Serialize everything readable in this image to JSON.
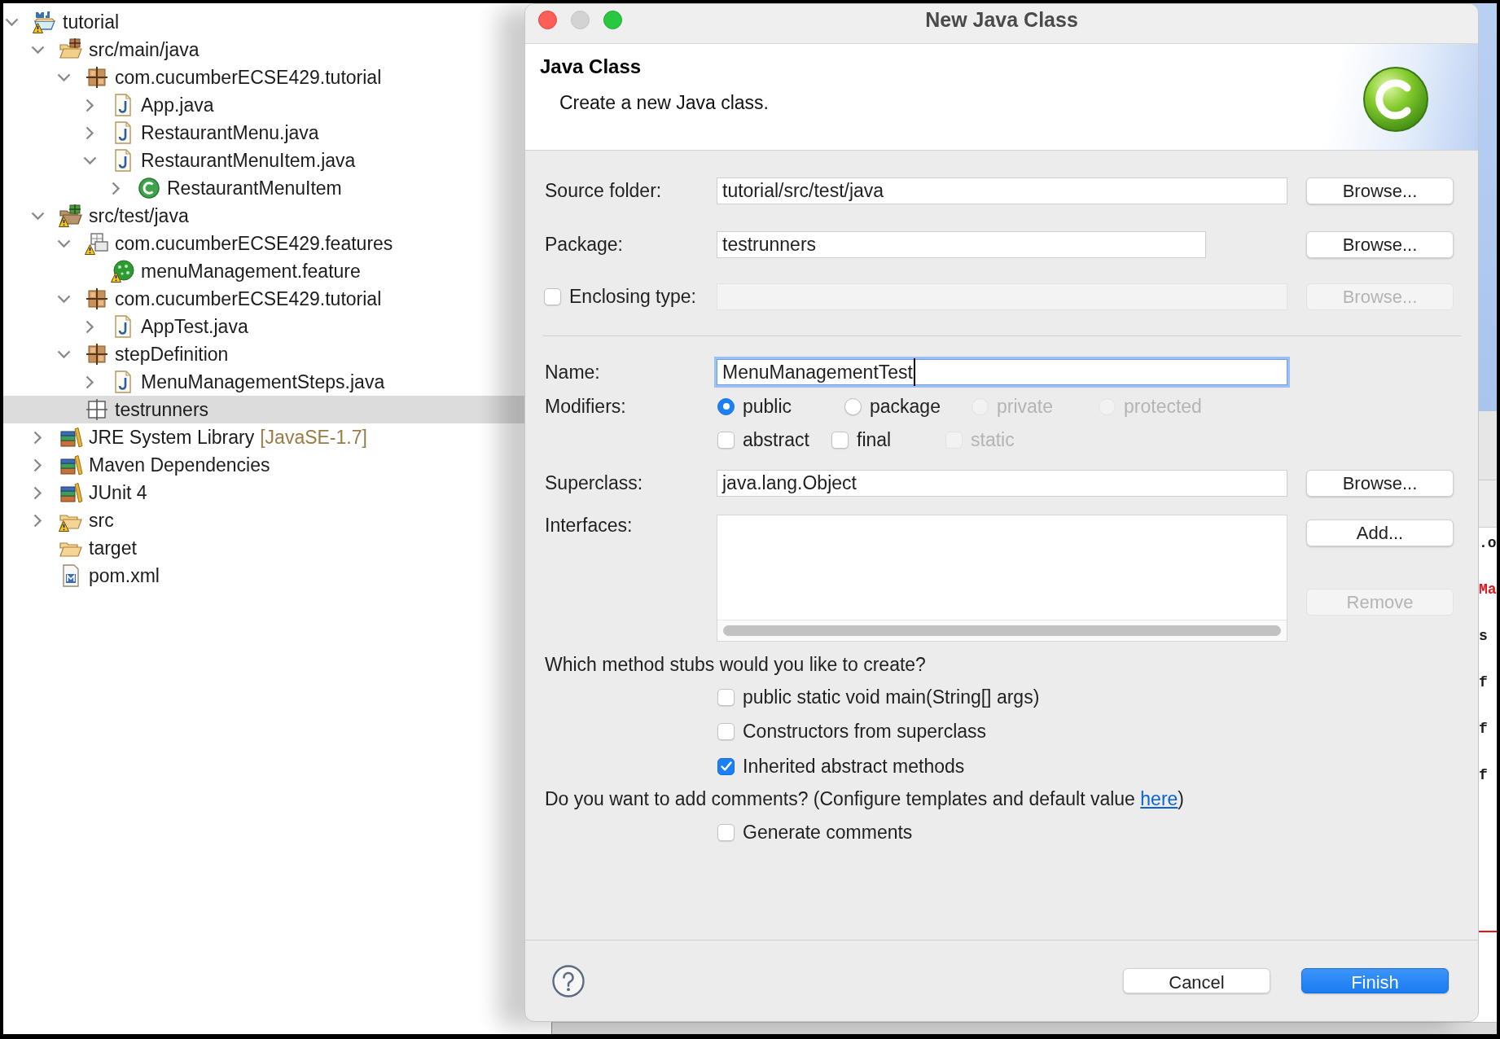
{
  "explorer": {
    "tree": [
      {
        "label": "tutorial",
        "kind": "project",
        "warning": true,
        "expanded": true,
        "selected": false,
        "children": [
          {
            "label": "src/main/java",
            "kind": "source_folder",
            "warning": false,
            "expanded": true,
            "selected": false,
            "children": [
              {
                "label": "com.cucumberECSE429.tutorial",
                "kind": "package",
                "warning": false,
                "expanded": true,
                "selected": false,
                "children": [
                  {
                    "label": "App.java",
                    "kind": "java_file",
                    "warning": false,
                    "expanded": false,
                    "selected": false
                  },
                  {
                    "label": "RestaurantMenu.java",
                    "kind": "java_file",
                    "warning": false,
                    "expanded": false,
                    "selected": false
                  },
                  {
                    "label": "RestaurantMenuItem.java",
                    "kind": "java_file",
                    "warning": false,
                    "expanded": true,
                    "selected": false,
                    "children": [
                      {
                        "label": "RestaurantMenuItem",
                        "kind": "class",
                        "warning": false,
                        "expanded": false,
                        "selected": false
                      }
                    ]
                  }
                ]
              }
            ]
          },
          {
            "label": "src/test/java",
            "kind": "test_source_folder",
            "warning": true,
            "expanded": true,
            "selected": false,
            "children": [
              {
                "label": "com.cucumberECSE429.features",
                "kind": "resource_package",
                "warning": true,
                "expanded": true,
                "selected": false,
                "children": [
                  {
                    "label": "menuManagement.feature",
                    "kind": "feature_file",
                    "warning": true,
                    "selected": false
                  }
                ]
              },
              {
                "label": "com.cucumberECSE429.tutorial",
                "kind": "package",
                "warning": false,
                "expanded": true,
                "selected": false,
                "children": [
                  {
                    "label": "AppTest.java",
                    "kind": "java_file",
                    "warning": false,
                    "expanded": false,
                    "selected": false
                  }
                ]
              },
              {
                "label": "stepDefinition",
                "kind": "package",
                "warning": false,
                "expanded": true,
                "selected": false,
                "children": [
                  {
                    "label": "MenuManagementSteps.java",
                    "kind": "java_file",
                    "warning": false,
                    "expanded": false,
                    "selected": false
                  }
                ]
              },
              {
                "label": "testrunners",
                "kind": "empty_package",
                "warning": false,
                "selected": true
              }
            ]
          },
          {
            "label": "JRE System Library",
            "decoration": "[JavaSE-1.7]",
            "kind": "library",
            "warning": false,
            "expanded": false,
            "selected": false
          },
          {
            "label": "Maven Dependencies",
            "kind": "library",
            "warning": false,
            "expanded": false,
            "selected": false
          },
          {
            "label": "JUnit 4",
            "kind": "library",
            "warning": false,
            "expanded": false,
            "selected": false
          },
          {
            "label": "src",
            "kind": "folder",
            "warning": true,
            "expanded": false,
            "selected": false
          },
          {
            "label": "target",
            "kind": "folder",
            "warning": false,
            "selected": false
          },
          {
            "label": "pom.xml",
            "kind": "xml_file",
            "warning": false,
            "selected": false
          }
        ]
      }
    ]
  },
  "editor": {
    "code_fragments": [
      {
        "text": ".o",
        "color": "#1a1a1a"
      },
      {
        "text": "Ma",
        "color": "#e0151b"
      },
      {
        "text": "s",
        "color": "#1a1a1a"
      },
      {
        "text": "f",
        "color": "#1a1a1a"
      },
      {
        "text": "f",
        "color": "#1a1a1a"
      },
      {
        "text": "f",
        "color": "#1a1a1a"
      }
    ]
  },
  "dialog": {
    "window": {
      "title": "New Java Class",
      "controls": [
        {
          "kind": "close",
          "disabled": false
        },
        {
          "kind": "minimize",
          "disabled": true
        },
        {
          "kind": "zoom",
          "disabled": false
        }
      ]
    },
    "header": {
      "title": "Java Class",
      "description": "Create a new Java class."
    },
    "source_folder": {
      "label": "Source folder:",
      "value": "tutorial/src/test/java",
      "button": {
        "label": "Browse...",
        "disabled": false
      }
    },
    "package": {
      "label": "Package:",
      "value": "testrunners",
      "button": {
        "label": "Browse...",
        "disabled": false
      }
    },
    "enclosing_type": {
      "label": "Enclosing type:",
      "checked": false,
      "disabled": true,
      "button": {
        "label": "Browse...",
        "disabled": true
      }
    },
    "name": {
      "label": "Name:",
      "value": "MenuManagementTest",
      "focused": true
    },
    "modifiers": {
      "label": "Modifiers:",
      "access": [
        {
          "label": "public",
          "selected": true,
          "disabled": false
        },
        {
          "label": "package",
          "selected": false,
          "disabled": false
        },
        {
          "label": "private",
          "selected": false,
          "disabled": true
        },
        {
          "label": "protected",
          "selected": false,
          "disabled": true
        }
      ],
      "flags": [
        {
          "label": "abstract",
          "checked": false,
          "disabled": false
        },
        {
          "label": "final",
          "checked": false,
          "disabled": false
        },
        {
          "label": "static",
          "checked": false,
          "disabled": true
        }
      ]
    },
    "superclass": {
      "label": "Superclass:",
      "value": "java.lang.Object",
      "button": {
        "label": "Browse...",
        "disabled": false
      }
    },
    "interfaces": {
      "label": "Interfaces:",
      "buttons": [
        {
          "label": "Add...",
          "disabled": false
        },
        {
          "label": "Remove",
          "disabled": true
        }
      ]
    },
    "method_stubs": {
      "question": "Which method stubs would you like to create?",
      "options": [
        {
          "label": "public static void main(String[] args)",
          "checked": false
        },
        {
          "label": "Constructors from superclass",
          "checked": false
        },
        {
          "label": "Inherited abstract methods",
          "checked": true
        }
      ]
    },
    "comments": {
      "question": "Do you want to add comments? (Configure templates and default value",
      "link": "here",
      "question_end": ")",
      "options": [
        {
          "label": "Generate comments",
          "checked": false
        }
      ]
    },
    "footer": {
      "buttons": [
        {
          "label": "Cancel",
          "kind": "secondary"
        },
        {
          "label": "Finish",
          "kind": "primary"
        }
      ]
    }
  }
}
